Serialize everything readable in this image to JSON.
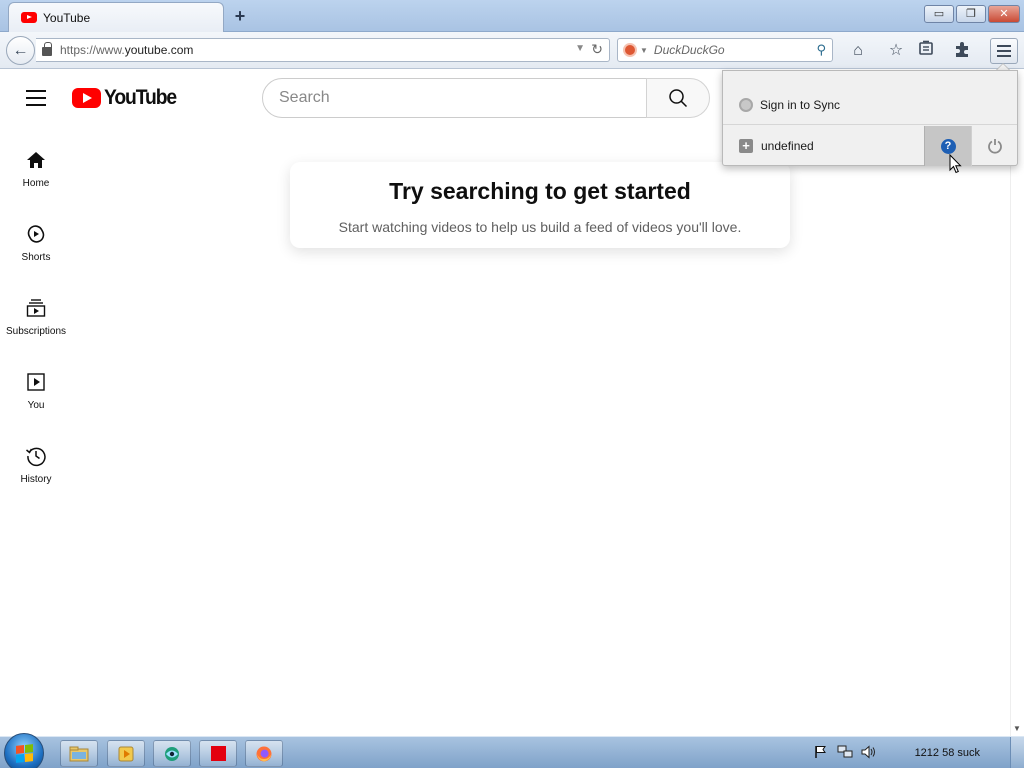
{
  "browser": {
    "tab_title": "YouTube",
    "new_tab_label": "+",
    "window_controls": {
      "minimize": "▭",
      "restore": "❐",
      "close": "✕"
    },
    "url_prefix": "https://www.",
    "url_domain": "youtube.com",
    "search_engine": "DuckDuckGo",
    "toolbar_icons": [
      "home-icon",
      "bookmark-star-icon",
      "reading-list-icon",
      "addons-icon",
      "menu-icon"
    ]
  },
  "menu_panel": {
    "sync_label": "Sign in to Sync",
    "customize_label": "undefined",
    "help_icon": "?",
    "quit_icon": "power-icon"
  },
  "youtube": {
    "logo_text": "YouTube",
    "search_placeholder": "Search",
    "sidebar": [
      {
        "label": "Home",
        "icon": "home-icon"
      },
      {
        "label": "Shorts",
        "icon": "shorts-icon"
      },
      {
        "label": "Subscriptions",
        "icon": "subscriptions-icon"
      },
      {
        "label": "You",
        "icon": "you-icon"
      },
      {
        "label": "History",
        "icon": "history-icon"
      }
    ],
    "empty_state": {
      "title": "Try searching to get started",
      "subtitle": "Start watching videos to help us build a feed of videos you'll love."
    }
  },
  "taskbar": {
    "pinned": [
      "explorer-icon",
      "media-player-icon",
      "network-app-icon",
      "red-square-app-icon",
      "firefox-icon"
    ],
    "clock": "1212 58 suck"
  },
  "colors": {
    "youtube_red": "#ff0000",
    "help_blue": "#1e5fb4",
    "titlebar_blue": "#a9c3e3"
  }
}
